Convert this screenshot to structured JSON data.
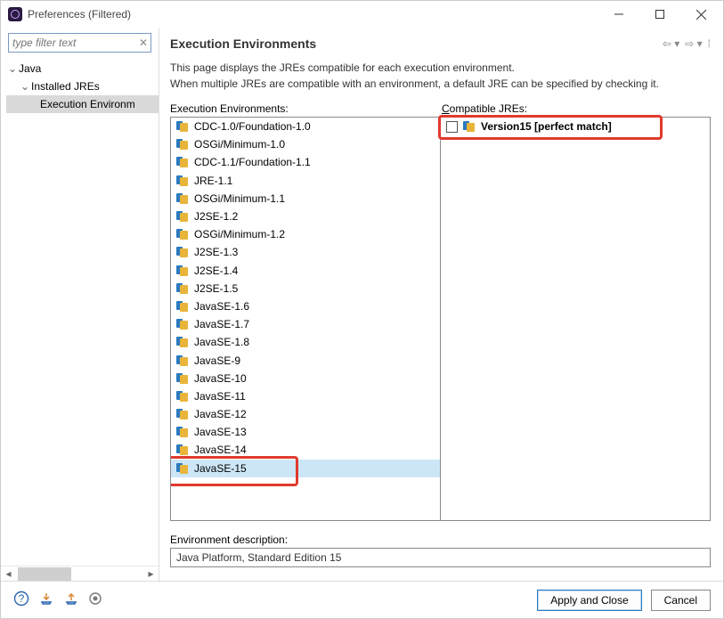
{
  "window": {
    "title": "Preferences (Filtered)"
  },
  "filter": {
    "placeholder": "type filter text"
  },
  "tree": {
    "root": "Java",
    "child": "Installed JREs",
    "leaf": "Execution Environm"
  },
  "page": {
    "title": "Execution Environments",
    "desc1": "This page displays the JREs compatible for each execution environment.",
    "desc2": "When multiple JREs are compatible with an environment, a default JRE can be specified by checking it.",
    "env_label": "Execution Environments:",
    "jre_label": "Compatible JREs:",
    "environments": [
      "CDC-1.0/Foundation-1.0",
      "OSGi/Minimum-1.0",
      "CDC-1.1/Foundation-1.1",
      "JRE-1.1",
      "OSGi/Minimum-1.1",
      "J2SE-1.2",
      "OSGi/Minimum-1.2",
      "J2SE-1.3",
      "J2SE-1.4",
      "J2SE-1.5",
      "JavaSE-1.6",
      "JavaSE-1.7",
      "JavaSE-1.8",
      "JavaSE-9",
      "JavaSE-10",
      "JavaSE-11",
      "JavaSE-12",
      "JavaSE-13",
      "JavaSE-14",
      "JavaSE-15"
    ],
    "selected_env_index": 19,
    "compatible_jre": "Version15 [perfect match]",
    "env_desc_label": "Environment description:",
    "env_desc_value": "Java Platform, Standard Edition 15"
  },
  "buttons": {
    "apply": "Apply and Close",
    "cancel": "Cancel"
  }
}
